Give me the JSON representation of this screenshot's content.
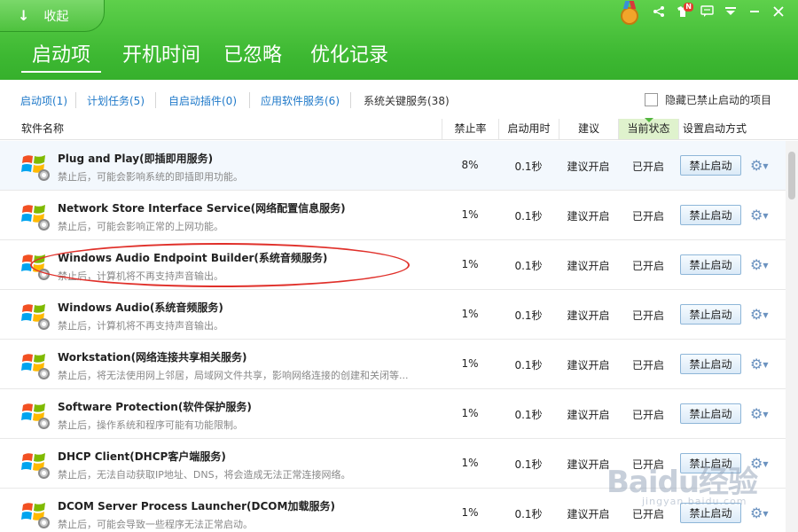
{
  "header": {
    "collapse_label": "收起",
    "main_tabs": [
      {
        "label": "启动项",
        "active": true
      },
      {
        "label": "开机时间",
        "active": false
      },
      {
        "label": "已忽略",
        "active": false
      },
      {
        "label": "优化记录",
        "active": false
      }
    ],
    "badge": "N",
    "icons": [
      "medal-icon",
      "share-icon",
      "tshirt-icon",
      "message-icon",
      "menu-icon",
      "minimize-icon",
      "close-icon"
    ]
  },
  "subtabs": {
    "items": [
      {
        "label": "启动项(1)"
      },
      {
        "label": "计划任务(5)"
      },
      {
        "label": "自启动插件(0)"
      },
      {
        "label": "应用软件服务(6)"
      },
      {
        "label": "系统关键服务(38)"
      }
    ],
    "hide_disabled_label": "隐藏已禁止启动的项目"
  },
  "columns": {
    "name": "软件名称",
    "rate": "禁止率",
    "time": "启动用时",
    "advice": "建议",
    "state": "当前状态",
    "setting": "设置启动方式"
  },
  "rows": [
    {
      "name": "Plug and Play(即插即用服务)",
      "desc": "禁止后，可能会影响系统的即插即用功能。",
      "rate": "8%",
      "time": "0.1秒",
      "advice": "建议开启",
      "state": "已开启",
      "button": "禁止启动"
    },
    {
      "name": "Network Store Interface Service(网络配置信息服务)",
      "desc": "禁止后，可能会影响正常的上网功能。",
      "rate": "1%",
      "time": "0.1秒",
      "advice": "建议开启",
      "state": "已开启",
      "button": "禁止启动"
    },
    {
      "name": "Windows Audio Endpoint Builder(系统音频服务)",
      "desc": "禁止后，计算机将不再支持声音输出。",
      "rate": "1%",
      "time": "0.1秒",
      "advice": "建议开启",
      "state": "已开启",
      "button": "禁止启动"
    },
    {
      "name": "Windows Audio(系统音频服务)",
      "desc": "禁止后，计算机将不再支持声音输出。",
      "rate": "1%",
      "time": "0.1秒",
      "advice": "建议开启",
      "state": "已开启",
      "button": "禁止启动"
    },
    {
      "name": "Workstation(网络连接共享相关服务)",
      "desc": "禁止后，将无法使用网上邻居，局域网文件共享，影响网络连接的创建和关闭等...",
      "rate": "1%",
      "time": "0.1秒",
      "advice": "建议开启",
      "state": "已开启",
      "button": "禁止启动"
    },
    {
      "name": "Software Protection(软件保护服务)",
      "desc": "禁止后，操作系统和程序可能有功能限制。",
      "rate": "1%",
      "time": "0.1秒",
      "advice": "建议开启",
      "state": "已开启",
      "button": "禁止启动"
    },
    {
      "name": "DHCP Client(DHCP客户端服务)",
      "desc": "禁止后，无法自动获取IP地址、DNS，将会造成无法正常连接网络。",
      "rate": "1%",
      "time": "0.1秒",
      "advice": "建议开启",
      "state": "已开启",
      "button": "禁止启动"
    },
    {
      "name": "DCOM Server Process Launcher(DCOM加载服务)",
      "desc": "禁止后，可能会导致一些程序无法正常启动。",
      "rate": "1%",
      "time": "0.1秒",
      "advice": "建议开启",
      "state": "已开启",
      "button": "禁止启动"
    }
  ],
  "watermark": {
    "logo": "Baidu经验",
    "sub": "jingyan.baidu.com"
  },
  "colors": {
    "header_green": "#3db832",
    "link_blue": "#1f79c9",
    "annotation_red": "#e0302a"
  }
}
